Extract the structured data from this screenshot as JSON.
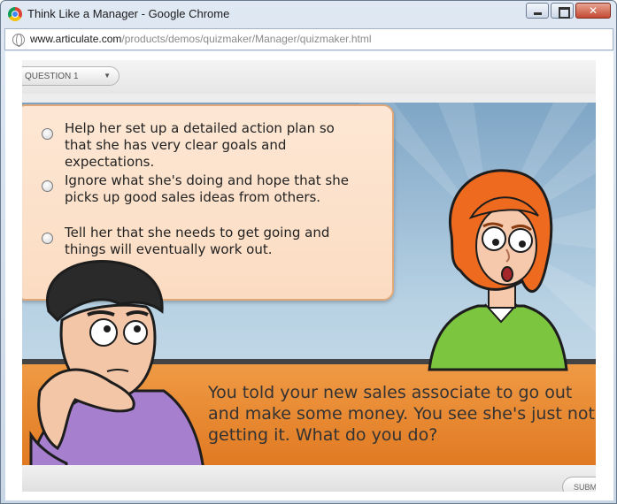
{
  "window": {
    "title": "Think Like a Manager - Google Chrome",
    "url_host": "www.articulate.com",
    "url_path": "/products/demos/quizmaker/Manager/quizmaker.html"
  },
  "player": {
    "question_selector": "QUESTION 1",
    "submit_label": "SUBMIT",
    "answers": [
      "Help her set up a detailed action plan so that she has very clear goals and expectations.",
      "Ignore what she's doing and hope that she picks up good sales ideas from others.",
      "Tell her that she needs to get going and things will eventually work out."
    ],
    "question": "You told your new sales associate to go out and make some money.  You see she's just not getting it.  What do you do?"
  },
  "colors": {
    "floor": "#e98a33",
    "sky": "#9dbdd8",
    "answer_box": "#fde2cc",
    "woman_hair": "#ee6a1f",
    "woman_shirt": "#7cc63f",
    "man_shirt": "#a77fcf"
  }
}
